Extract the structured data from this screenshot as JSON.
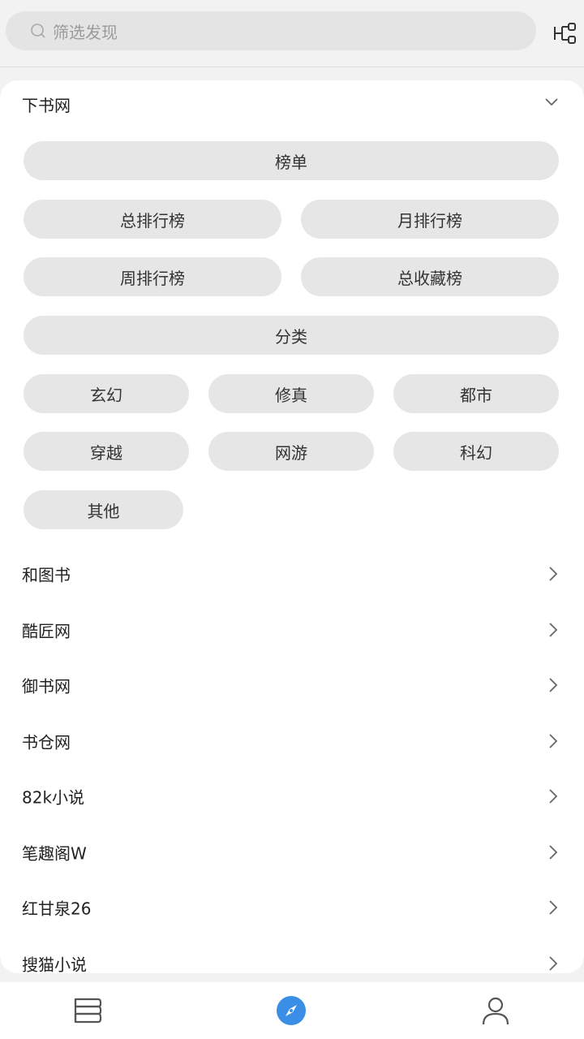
{
  "search": {
    "placeholder": "筛选发现"
  },
  "group": {
    "title": "下书网",
    "chips": [
      {
        "label": "榜单"
      },
      {
        "label": "总排行榜"
      },
      {
        "label": "月排行榜"
      },
      {
        "label": "周排行榜"
      },
      {
        "label": "总收藏榜"
      },
      {
        "label": "分类"
      },
      {
        "label": "玄幻"
      },
      {
        "label": "修真"
      },
      {
        "label": "都市"
      },
      {
        "label": "穿越"
      },
      {
        "label": "网游"
      },
      {
        "label": "科幻"
      },
      {
        "label": "其他"
      }
    ]
  },
  "sources": [
    {
      "label": "和图书"
    },
    {
      "label": "酷匠网"
    },
    {
      "label": "御书网"
    },
    {
      "label": "书仓网"
    },
    {
      "label": "82k小说"
    },
    {
      "label": "笔趣阁W"
    },
    {
      "label": "红甘泉26"
    },
    {
      "label": "搜猫小说"
    }
  ],
  "colors": {
    "accent": "#3a8ee6",
    "chip_bg": "#e6e6e6",
    "icon_gray": "#555555"
  },
  "nav": [
    {
      "icon": "bookshelf-icon"
    },
    {
      "icon": "compass-icon"
    },
    {
      "icon": "person-icon"
    }
  ]
}
